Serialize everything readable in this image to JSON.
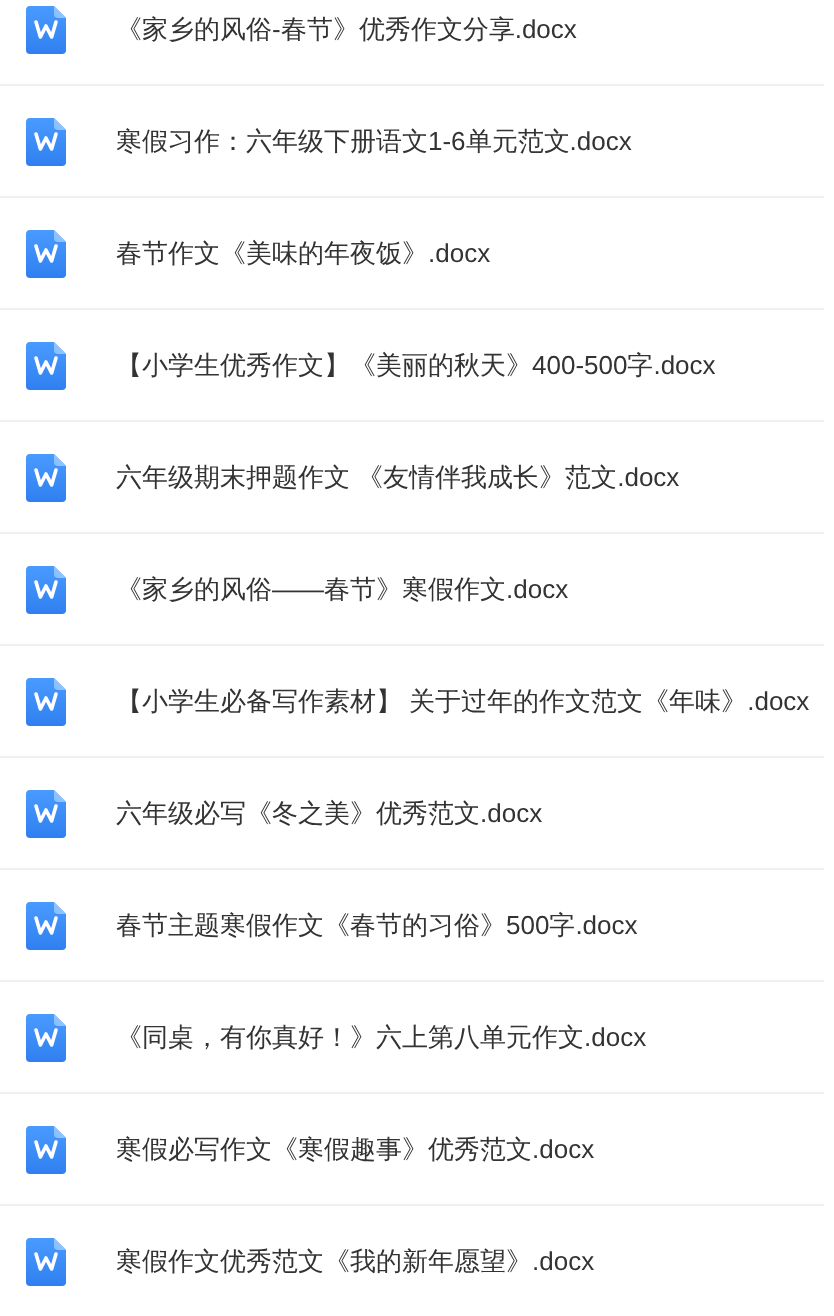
{
  "files": [
    {
      "name": "《家乡的风俗-春节》优秀作文分享.docx"
    },
    {
      "name": "寒假习作：六年级下册语文1-6单元范文.docx"
    },
    {
      "name": "春节作文《美味的年夜饭》.docx"
    },
    {
      "name": "【小学生优秀作文】《美丽的秋天》400-500字.docx"
    },
    {
      "name": "六年级期末押题作文 《友情伴我成长》范文.docx"
    },
    {
      "name": "《家乡的风俗——春节》寒假作文.docx"
    },
    {
      "name": "【小学生必备写作素材】 关于过年的作文范文《年味》.docx"
    },
    {
      "name": "六年级必写《冬之美》优秀范文.docx"
    },
    {
      "name": "春节主题寒假作文《春节的习俗》500字.docx"
    },
    {
      "name": "《同桌，有你真好！》六上第八单元作文.docx"
    },
    {
      "name": "寒假必写作文《寒假趣事》优秀范文.docx"
    },
    {
      "name": "寒假作文优秀范文《我的新年愿望》.docx"
    }
  ]
}
